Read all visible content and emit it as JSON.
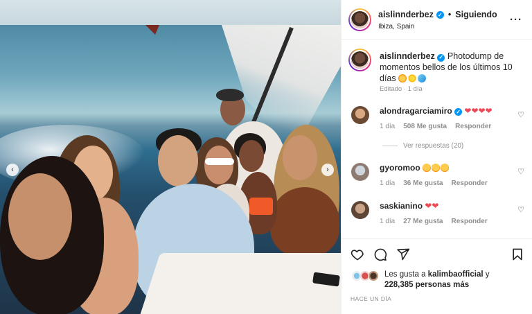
{
  "post": {
    "header": {
      "username": "aislinnderbez",
      "separator": "•",
      "follow_status": "Siguiendo",
      "location": "Ibiza, Spain",
      "more_icon": "more-horizontal-icon"
    },
    "caption": {
      "username": "aislinnderbez",
      "text": "Photodump de momentos bellos de los últimos 10 días",
      "meta": "Editado · 1 día"
    },
    "comments": [
      {
        "username": "alondragarciamiro",
        "text_icons": [
          "red-heart",
          "red-heart",
          "red-heart",
          "red-heart"
        ],
        "time": "1 día",
        "likes": "508 Me gusta",
        "reply": "Responder"
      },
      {
        "username": "gyoromoo",
        "text_icons": [
          "star-struck-emoji",
          "star-struck-emoji",
          "star-struck-emoji"
        ],
        "time": "1 día",
        "likes": "36 Me gusta",
        "reply": "Responder"
      },
      {
        "username": "saskianino",
        "text_icons": [
          "red-heart",
          "red-heart"
        ],
        "time": "1 día",
        "likes": "27 Me gusta",
        "reply": "Responder"
      }
    ],
    "view_replies": "Ver respuestas (20)",
    "likes": {
      "prefix": "Les gusta a",
      "first_user": "kalimbaofficial",
      "connector": "y",
      "count": "228,385 personas más"
    },
    "timestamp": "HACE UN DÍA"
  },
  "colors": {
    "verified": "#0095f6",
    "heart_red": "#ed4956",
    "secondary_text": "#8e8e8e"
  }
}
